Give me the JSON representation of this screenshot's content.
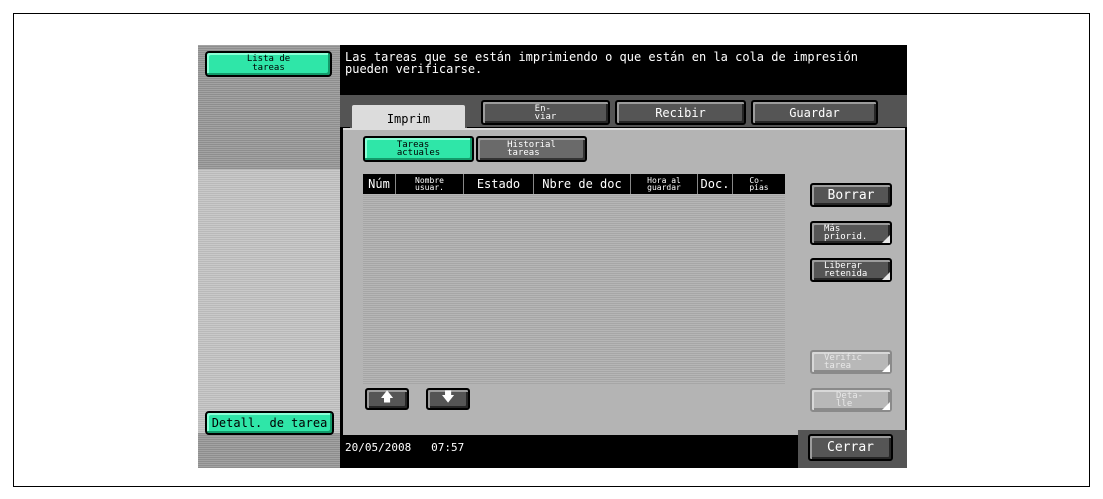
{
  "sidebar": {
    "task_list_label": "Lista de\ntareas",
    "task_details_label": "Detall. de tarea"
  },
  "message": "Las tareas que se están imprimiendo o que están en la cola de impresión\npueden verificarse.",
  "tabs": [
    {
      "label": "Imprim",
      "active": true
    },
    {
      "label": "En-\nviar",
      "active": false
    },
    {
      "label": "Recibir",
      "active": false
    },
    {
      "label": "Guardar",
      "active": false
    }
  ],
  "subtabs": [
    {
      "label": "Tareas\nactuales",
      "active": true
    },
    {
      "label": "Historial\ntareas",
      "active": false
    }
  ],
  "table": {
    "columns": [
      "Núm",
      "Nombre\nusuar.",
      "Estado",
      "Nbre de doc",
      "Hora al\nguardar",
      "Doc.",
      "Co-\npias"
    ],
    "rows": []
  },
  "actions": {
    "delete": "Borrar",
    "raise_priority": "Más\npriorid.",
    "release_held": "Liberar\nretenida",
    "check_job": "Verific\ntarea",
    "detail": "Deta-\nlle",
    "close": "Cerrar"
  },
  "arrows": {
    "up": "🡅",
    "down": "🡇"
  },
  "status": {
    "date": "20/05/2008",
    "time": "07:57"
  },
  "colors": {
    "accent": "#2fe6a8",
    "screen_bg": "#000000",
    "panel_bg": "#b4b4b4"
  }
}
